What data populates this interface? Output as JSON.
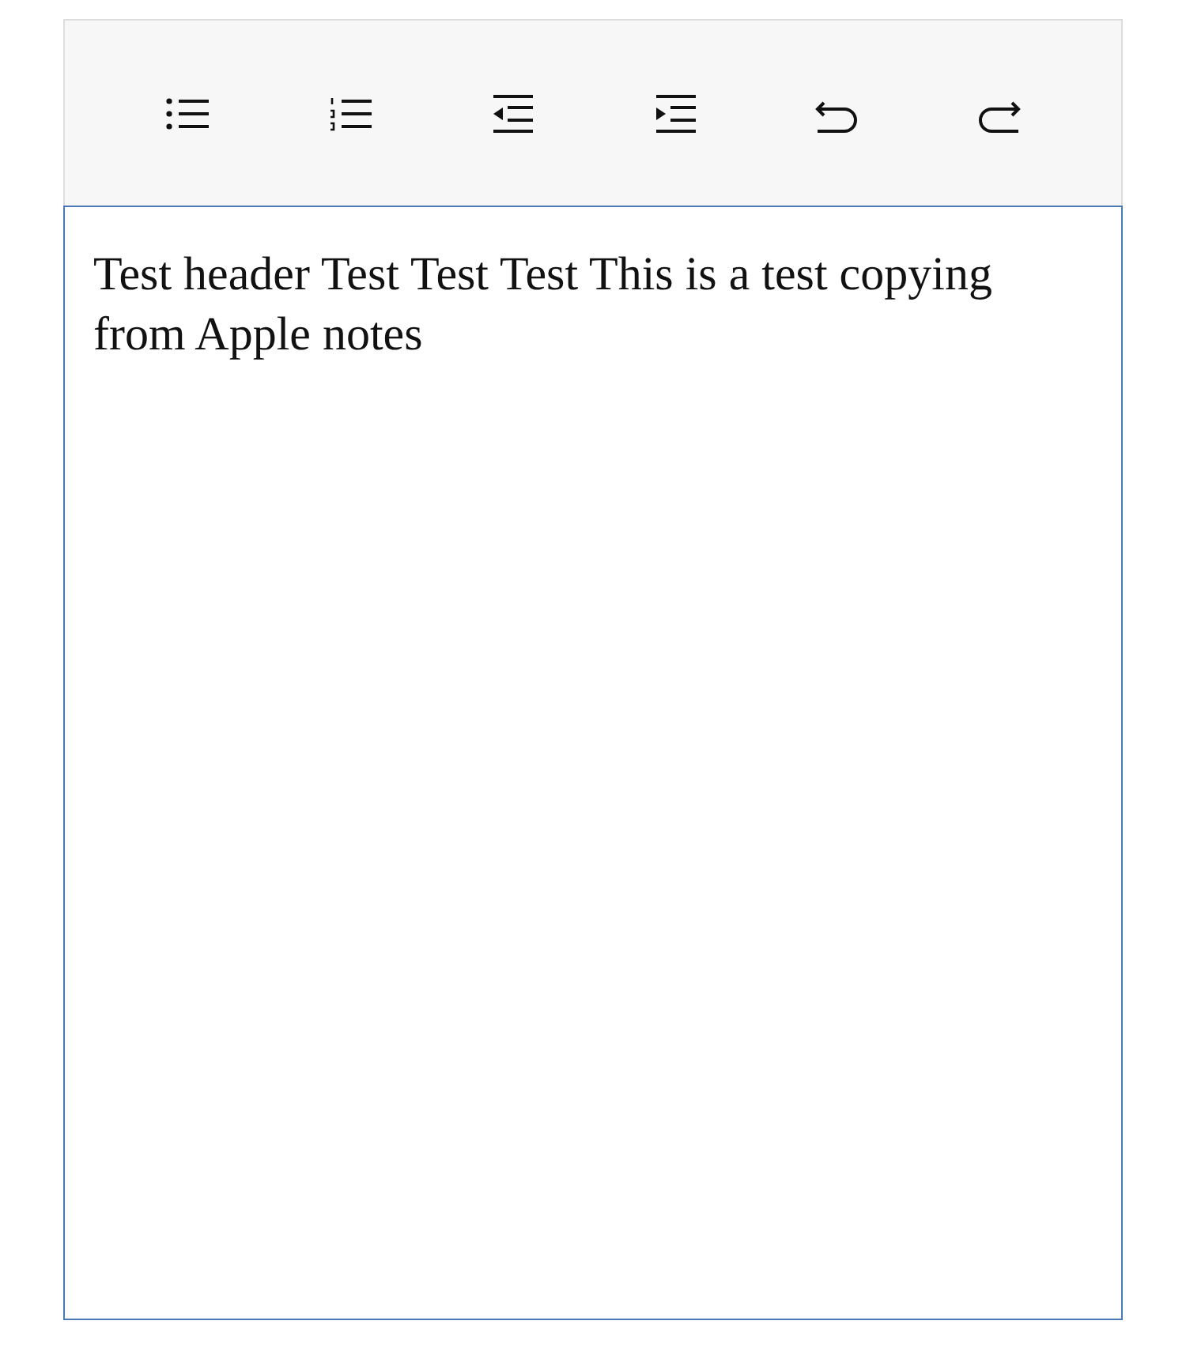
{
  "toolbar": {
    "buttons": [
      {
        "kind": "bullet-list"
      },
      {
        "kind": "numbered-list"
      },
      {
        "kind": "outdent"
      },
      {
        "kind": "indent"
      },
      {
        "kind": "undo"
      },
      {
        "kind": "redo"
      }
    ]
  },
  "editor": {
    "value": "Test header Test Test Test This is a test copying from Apple notes"
  }
}
